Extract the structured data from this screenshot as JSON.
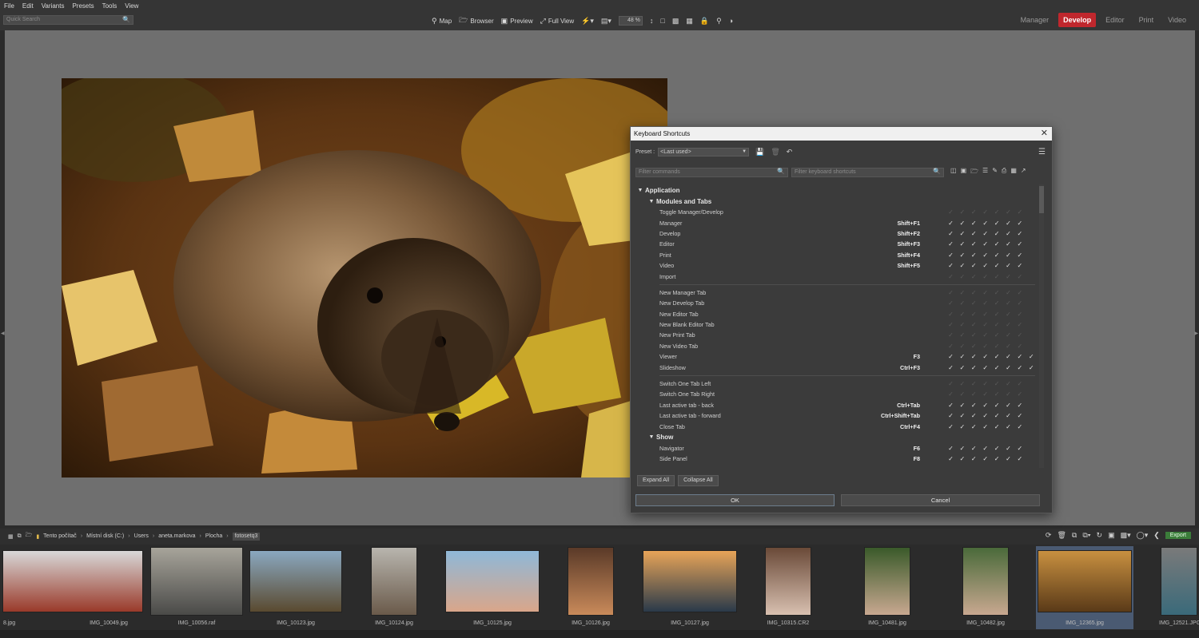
{
  "menu": [
    "File",
    "Edit",
    "Variants",
    "Presets",
    "Tools",
    "View"
  ],
  "quick_search": {
    "placeholder": "Quick Search"
  },
  "view_toolbar": {
    "map": "Map",
    "browser": "Browser",
    "preview": "Preview",
    "full_view": "Full View",
    "zoom": "48 %"
  },
  "modules": [
    "Manager",
    "Develop",
    "Editor",
    "Print",
    "Video"
  ],
  "active_module": "Develop",
  "colors": {
    "accent": "#c0272d",
    "export": "#3b7d3a"
  },
  "dialog": {
    "title": "Keyboard Shortcuts",
    "preset_label": "Preset :",
    "preset_value": "<Last used>",
    "filter_commands": "Filter commands",
    "filter_shortcuts": "Filter keyboard shortcuts",
    "expand_all": "Expand All",
    "collapse_all": "Collapse All",
    "ok": "OK",
    "cancel": "Cancel",
    "sections": [
      {
        "name": "Application",
        "level": 0
      },
      {
        "name": "Modules and Tabs",
        "level": 1
      },
      {
        "cmd": "Toggle Manager/Develop",
        "key": "",
        "checks": [
          0,
          0,
          0,
          0,
          0,
          0,
          0
        ]
      },
      {
        "cmd": "Manager",
        "key": "Shift+F1",
        "checks": [
          1,
          1,
          1,
          1,
          1,
          1,
          1
        ]
      },
      {
        "cmd": "Develop",
        "key": "Shift+F2",
        "checks": [
          1,
          1,
          1,
          1,
          1,
          1,
          1
        ]
      },
      {
        "cmd": "Editor",
        "key": "Shift+F3",
        "checks": [
          1,
          1,
          1,
          1,
          1,
          1,
          1
        ]
      },
      {
        "cmd": "Print",
        "key": "Shift+F4",
        "checks": [
          1,
          1,
          1,
          1,
          1,
          1,
          1
        ]
      },
      {
        "cmd": "Video",
        "key": "Shift+F5",
        "checks": [
          1,
          1,
          1,
          1,
          1,
          1,
          1
        ]
      },
      {
        "cmd": "Import",
        "key": "",
        "checks": [
          0,
          0,
          0,
          0,
          0,
          0,
          0
        ]
      },
      {
        "divider": true
      },
      {
        "cmd": "New Manager Tab",
        "key": "",
        "checks": [
          0,
          0,
          0,
          0,
          0,
          0,
          0
        ]
      },
      {
        "cmd": "New Develop Tab",
        "key": "",
        "checks": [
          0,
          0,
          0,
          0,
          0,
          0,
          0
        ]
      },
      {
        "cmd": "New Editor Tab",
        "key": "",
        "checks": [
          0,
          0,
          0,
          0,
          0,
          0,
          0
        ]
      },
      {
        "cmd": "New Blank Editor Tab",
        "key": "",
        "checks": [
          0,
          0,
          0,
          0,
          0,
          0,
          0
        ]
      },
      {
        "cmd": "New Print Tab",
        "key": "",
        "checks": [
          0,
          0,
          0,
          0,
          0,
          0,
          0
        ]
      },
      {
        "cmd": "New Video Tab",
        "key": "",
        "checks": [
          0,
          0,
          0,
          0,
          0,
          0,
          0
        ]
      },
      {
        "cmd": "Viewer",
        "key": "F3",
        "checks": [
          1,
          1,
          1,
          1,
          1,
          1,
          1,
          1
        ]
      },
      {
        "cmd": "Slideshow",
        "key": "Ctrl+F3",
        "checks": [
          1,
          1,
          1,
          1,
          1,
          1,
          1,
          1
        ]
      },
      {
        "divider": true
      },
      {
        "cmd": "Switch One Tab Left",
        "key": "",
        "checks": [
          0,
          0,
          0,
          0,
          0,
          0,
          0
        ]
      },
      {
        "cmd": "Switch One Tab Right",
        "key": "",
        "checks": [
          0,
          0,
          0,
          0,
          0,
          0,
          0
        ]
      },
      {
        "cmd": "Last active tab - back",
        "key": "Ctrl+Tab",
        "checks": [
          1,
          1,
          1,
          1,
          1,
          1,
          1
        ]
      },
      {
        "cmd": "Last active tab - forward",
        "key": "Ctrl+Shift+Tab",
        "checks": [
          1,
          1,
          1,
          1,
          1,
          1,
          1
        ]
      },
      {
        "cmd": "Close Tab",
        "key": "Ctrl+F4",
        "checks": [
          1,
          1,
          1,
          1,
          1,
          1,
          1
        ]
      },
      {
        "name": "Show",
        "level": 1
      },
      {
        "cmd": "Navigator",
        "key": "F6",
        "checks": [
          1,
          1,
          1,
          1,
          1,
          1,
          1
        ]
      },
      {
        "cmd": "Side Panel",
        "key": "F8",
        "checks": [
          1,
          1,
          1,
          1,
          1,
          1,
          1
        ]
      }
    ]
  },
  "breadcrumb": [
    "Tento počítač",
    "Místní disk (C:)",
    "Users",
    "aneta.markova",
    "Plocha",
    "fotosetq3"
  ],
  "export_label": "Export",
  "thumbnails": [
    {
      "name": "IMG_10049.jpg",
      "prefix": "8.jpg"
    },
    {
      "name": "IMG_10056.raf"
    },
    {
      "name": "IMG_10123.jpg"
    },
    {
      "name": "IMG_10124.jpg"
    },
    {
      "name": "IMG_10125.jpg"
    },
    {
      "name": "IMG_10126.jpg"
    },
    {
      "name": "IMG_10127.jpg"
    },
    {
      "name": "IMG_10315.CR2"
    },
    {
      "name": "IMG_10481.jpg"
    },
    {
      "name": "IMG_10482.jpg"
    },
    {
      "name": "IMG_12365.jpg",
      "selected": true
    },
    {
      "name": "IMG_12521.JPG"
    }
  ]
}
